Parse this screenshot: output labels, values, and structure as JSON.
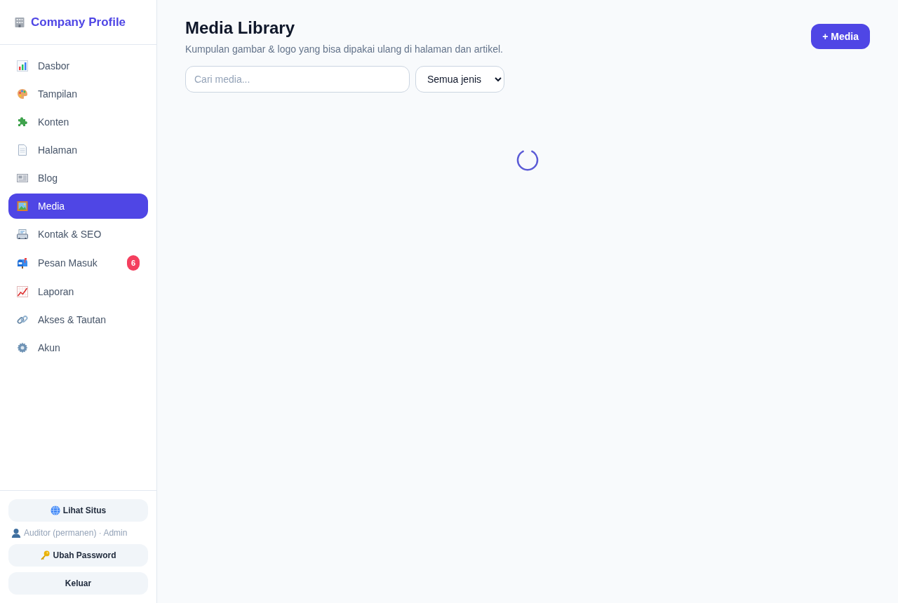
{
  "sidebar": {
    "brand": "Company Profile",
    "items": [
      {
        "label": "Dasbor",
        "selected": false
      },
      {
        "label": "Tampilan",
        "selected": false
      },
      {
        "label": "Konten",
        "selected": false
      },
      {
        "label": "Halaman",
        "selected": false
      },
      {
        "label": "Blog",
        "selected": false
      },
      {
        "label": "Media",
        "selected": true
      },
      {
        "label": "Kontak & SEO",
        "selected": false
      },
      {
        "label": "Pesan Masuk",
        "selected": false,
        "badge": "6"
      },
      {
        "label": "Laporan",
        "selected": false
      },
      {
        "label": "Akses & Tautan",
        "selected": false
      },
      {
        "label": "Akun",
        "selected": false
      }
    ],
    "footer": {
      "view_site_button": "Lihat Situs",
      "user": "Auditor (permanen) · Admin",
      "change_password_button": "Ubah Password",
      "logout_button": "Keluar"
    }
  },
  "main": {
    "title": "Media Library",
    "subtitle": "Kumpulan gambar & logo yang bisa dipakai ulang di halaman dan artikel.",
    "add_button": "+ Media",
    "search": {
      "placeholder": "Cari media..."
    },
    "type_filter": {
      "value": "Semua jenis"
    },
    "loading": true
  }
}
